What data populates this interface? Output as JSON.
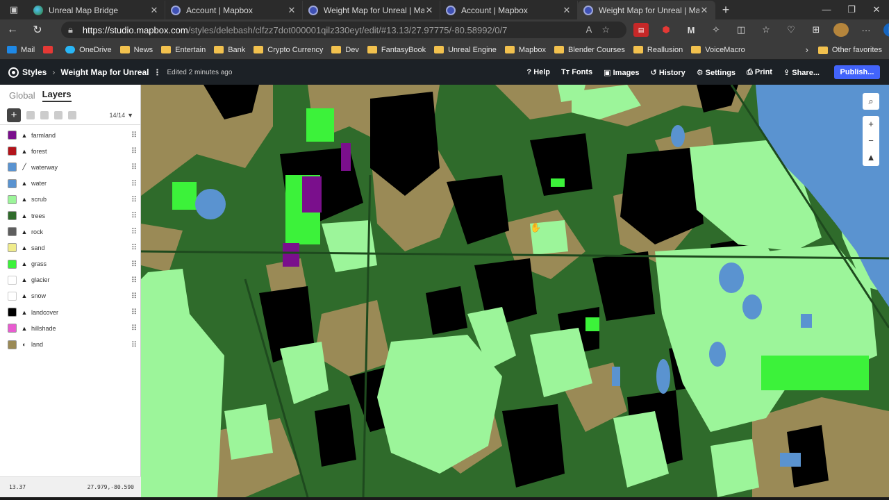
{
  "browser": {
    "tabs": [
      {
        "title": "Unreal Map Bridge",
        "icon": "globe",
        "active": false
      },
      {
        "title": "Account | Mapbox",
        "icon": "mapbox",
        "active": false
      },
      {
        "title": "Weight Map for Unreal | Mapbox",
        "icon": "mapbox",
        "active": false
      },
      {
        "title": "Account | Mapbox",
        "icon": "mapbox",
        "active": false
      },
      {
        "title": "Weight Map for Unreal | Mapbox",
        "icon": "mapbox",
        "active": true
      }
    ],
    "url_host": "https://studio.mapbox.com",
    "url_path": "/styles/delebash/clfzz7dot000001qilz330eyt/edit/#13.13/27.97775/-80.58992/0/7",
    "bookmarks": [
      "Mail",
      "OneDrive",
      "News",
      "Entertain",
      "Bank",
      "Crypto Currency",
      "Dev",
      "FantasyBook",
      "Unreal Engine",
      "Mapbox",
      "Blender Courses",
      "Reallusion",
      "VoiceMacro"
    ],
    "other_favorites": "Other favorites"
  },
  "app": {
    "styles_label": "Styles",
    "map_name": "Weight Map for Unreal",
    "edited": "Edited 2 minutes ago",
    "menu": {
      "help": "Help",
      "fonts": "Fonts",
      "images": "Images",
      "history": "History",
      "settings": "Settings",
      "print": "Print",
      "share": "Share..."
    },
    "publish": "Publish..."
  },
  "sidebar": {
    "tab_global": "Global",
    "tab_layers": "Layers",
    "count": "14/14",
    "layers": [
      {
        "name": "farmland",
        "color": "#7a0f8c",
        "type": "fill"
      },
      {
        "name": "forest",
        "color": "#b3141b",
        "type": "fill"
      },
      {
        "name": "waterway",
        "color": "#5a93d0",
        "type": "line"
      },
      {
        "name": "water",
        "color": "#5a93d0",
        "type": "fill"
      },
      {
        "name": "scrub",
        "color": "#9cf59a",
        "type": "fill"
      },
      {
        "name": "trees",
        "color": "#2f6b2b",
        "type": "fill"
      },
      {
        "name": "rock",
        "color": "#5e5e5e",
        "type": "fill"
      },
      {
        "name": "sand",
        "color": "#f0ec8c",
        "type": "fill"
      },
      {
        "name": "grass",
        "color": "#3cf23a",
        "type": "fill"
      },
      {
        "name": "glacier",
        "color": "#ffffff",
        "type": "fill"
      },
      {
        "name": "snow",
        "color": "#ffffff",
        "type": "fill"
      },
      {
        "name": "landcover",
        "color": "#000000",
        "type": "fill"
      },
      {
        "name": "hillshade",
        "color": "#e85cd0",
        "type": "fill"
      },
      {
        "name": "land",
        "color": "#9a8a56",
        "type": "background"
      }
    ],
    "zoom": "13.37",
    "coords": "27.979,-80.590"
  }
}
